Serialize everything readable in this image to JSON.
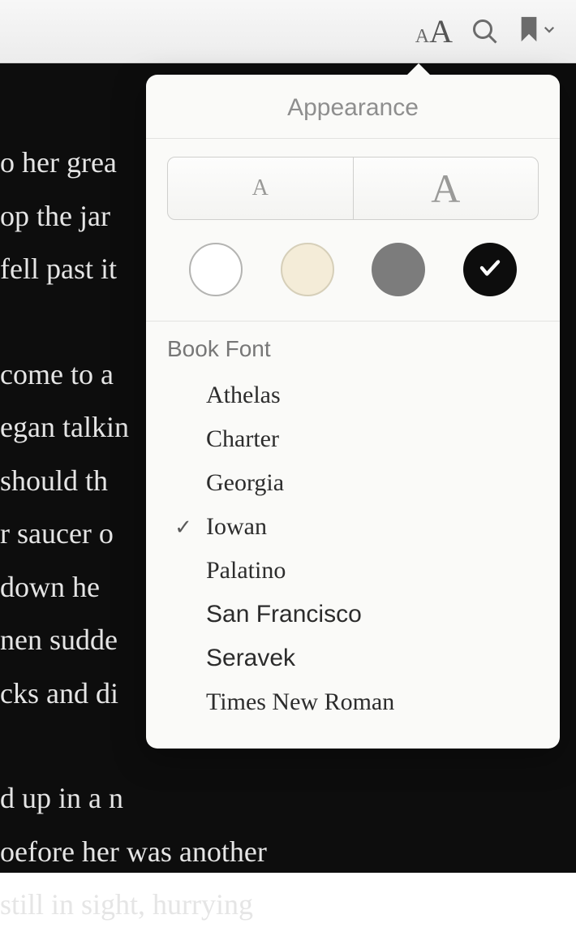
{
  "toolbar": {
    "font_size_icon": "font-size",
    "search_icon": "search",
    "bookmark_icon": "bookmark",
    "dropdown_icon": "chevron-down"
  },
  "reader": {
    "block1": {
      "line1": "o her grea",
      "line2": "op the jar",
      "line3": "fell past it"
    },
    "block2": {
      "line1": "come to a",
      "line2": "egan talkin",
      "line3": " should th",
      "line4": "r saucer o",
      "line5": " down he",
      "line6": "nen sudde",
      "line7": "cks and di"
    },
    "block3": {
      "line1": "d up in a n",
      "line2": "oefore her was another",
      "line3": " still in sight, hurrying"
    }
  },
  "popover": {
    "title": "Appearance",
    "size_small_label": "A",
    "size_large_label": "A",
    "themes": {
      "white": "#ffffff",
      "sepia": "#f4ecd8",
      "gray": "#7c7c7c",
      "night": "#0d0d0d",
      "selected": "night"
    },
    "font_section_label": "Book Font",
    "fonts": [
      {
        "name": "Athelas",
        "selected": false,
        "class": "font-athelas"
      },
      {
        "name": "Charter",
        "selected": false,
        "class": "font-charter"
      },
      {
        "name": "Georgia",
        "selected": false,
        "class": "font-georgia"
      },
      {
        "name": "Iowan",
        "selected": true,
        "class": "font-iowan"
      },
      {
        "name": "Palatino",
        "selected": false,
        "class": "font-palatino"
      },
      {
        "name": "San Francisco",
        "selected": false,
        "class": "font-sanfrancisco"
      },
      {
        "name": "Seravek",
        "selected": false,
        "class": "font-seravek"
      },
      {
        "name": "Times New Roman",
        "selected": false,
        "class": "font-times"
      }
    ],
    "checkmark": "✓"
  }
}
